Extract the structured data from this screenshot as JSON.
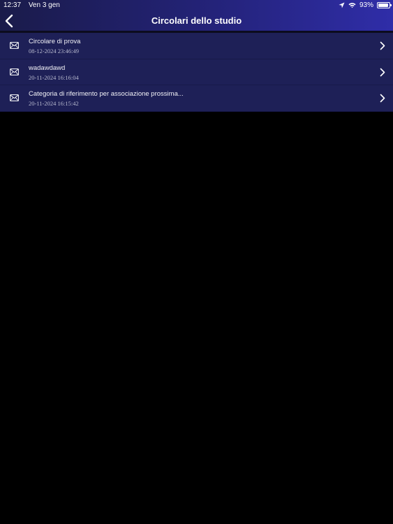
{
  "status_bar": {
    "time": "12:37",
    "date": "Ven 3 gen",
    "battery_percent": "93%",
    "battery_level": 0.93,
    "icons": [
      "location-arrow-icon",
      "wifi-icon",
      "battery-icon"
    ]
  },
  "nav": {
    "title": "Circolari dello studio",
    "back_icon": "chevron-left-icon"
  },
  "list": {
    "items": [
      {
        "title": "Circolare di prova",
        "date": "08-12-2024 23:46:49",
        "icon": "envelope-icon"
      },
      {
        "title": "wadawdawd",
        "date": "20-11-2024 16:16:04",
        "icon": "envelope-icon"
      },
      {
        "title": "Categoria di riferimento per associazione prossima...",
        "date": "20-11-2024 16:15:42",
        "icon": "envelope-icon"
      }
    ]
  },
  "colors": {
    "header_gradient_start": "#1a1b4a",
    "header_gradient_end": "#2f2da8",
    "row_background": "#1e2057",
    "page_background": "#000000"
  }
}
